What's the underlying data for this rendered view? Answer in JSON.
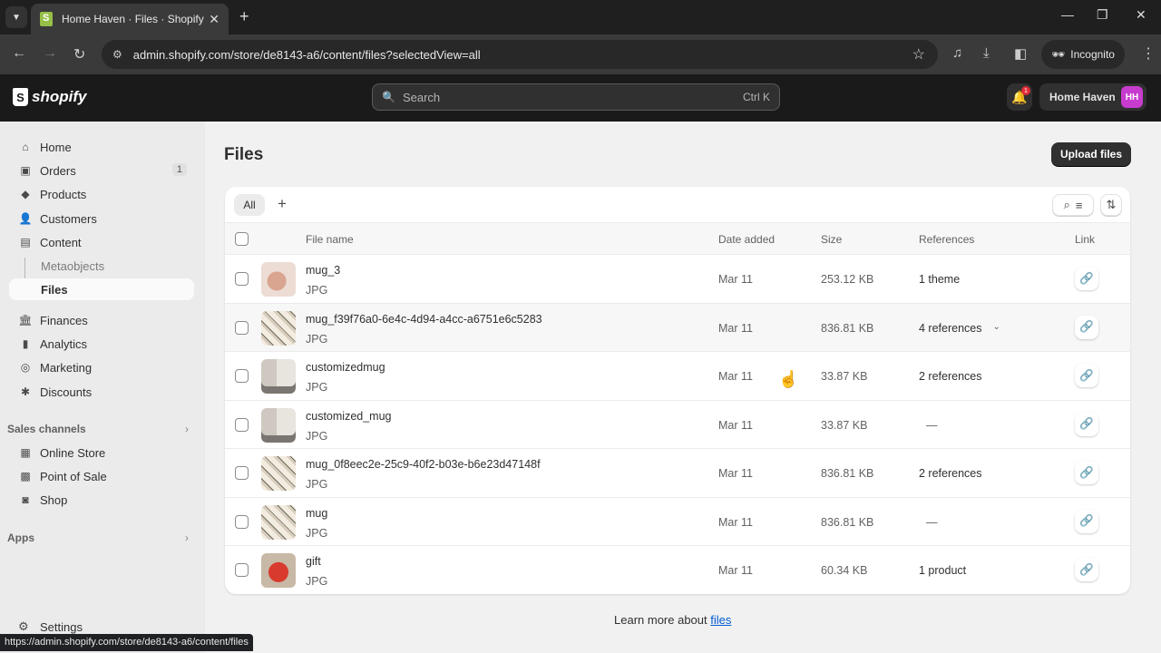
{
  "browser": {
    "tab_title": "Home Haven · Files · Shopify",
    "url": "admin.shopify.com/store/de8143-a6/content/files?selectedView=all",
    "profile_label": "Incognito",
    "status_url": "https://admin.shopify.com/store/de8143-a6/content/files"
  },
  "topbar": {
    "logo_text": "shopify",
    "search_placeholder": "Search",
    "search_shortcut": "Ctrl K",
    "notification_count": "1",
    "store_name": "Home Haven",
    "store_initials": "HH"
  },
  "sidebar": {
    "items": [
      {
        "label": "Home",
        "icon": "home-icon"
      },
      {
        "label": "Orders",
        "icon": "orders-icon",
        "count": "1"
      },
      {
        "label": "Products",
        "icon": "tag-icon"
      },
      {
        "label": "Customers",
        "icon": "person-icon"
      },
      {
        "label": "Content",
        "icon": "content-icon"
      }
    ],
    "content_subitems": [
      {
        "label": "Metaobjects"
      },
      {
        "label": "Files",
        "active": true
      }
    ],
    "items2": [
      {
        "label": "Finances",
        "icon": "bank-icon"
      },
      {
        "label": "Analytics",
        "icon": "bar-chart-icon"
      },
      {
        "label": "Marketing",
        "icon": "target-icon"
      },
      {
        "label": "Discounts",
        "icon": "discount-icon"
      }
    ],
    "sales_channels_label": "Sales channels",
    "sales_channels": [
      {
        "label": "Online Store",
        "icon": "store-icon"
      },
      {
        "label": "Point of Sale",
        "icon": "pos-icon"
      },
      {
        "label": "Shop",
        "icon": "shop-icon"
      }
    ],
    "apps_label": "Apps",
    "settings_label": "Settings"
  },
  "main": {
    "title": "Files",
    "upload_button": "Upload files",
    "view_tab": "All",
    "columns": {
      "file_name": "File name",
      "date_added": "Date added",
      "size": "Size",
      "references": "References",
      "link": "Link"
    },
    "rows": [
      {
        "name": "mug_3",
        "type": "JPG",
        "date": "Mar 11",
        "size": "253.12 KB",
        "refs": "1 theme",
        "thumb": "pink-mug"
      },
      {
        "name": "mug_f39f76a0-6e4c-4d94-a4cc-a6751e6c5283",
        "type": "JPG",
        "date": "Mar 11",
        "size": "836.81 KB",
        "refs": "4 references",
        "expandable": true,
        "thumb": "mug-collage"
      },
      {
        "name": "customizedmug",
        "type": "JPG",
        "date": "Mar 11",
        "size": "33.87 KB",
        "refs": "2 references",
        "thumb": "custom-mug"
      },
      {
        "name": "customized_mug",
        "type": "JPG",
        "date": "Mar 11",
        "size": "33.87 KB",
        "refs": "—",
        "thumb": "custom-mug"
      },
      {
        "name": "mug_0f8eec2e-25c9-40f2-b03e-b6e23d47148f",
        "type": "JPG",
        "date": "Mar 11",
        "size": "836.81 KB",
        "refs": "2 references",
        "thumb": "mug-collage"
      },
      {
        "name": "mug",
        "type": "JPG",
        "date": "Mar 11",
        "size": "836.81 KB",
        "refs": "—",
        "thumb": "mug-collage"
      },
      {
        "name": "gift",
        "type": "JPG",
        "date": "Mar 11",
        "size": "60.34 KB",
        "refs": "1 product",
        "thumb": "gift"
      }
    ],
    "learn_more_prefix": "Learn more about",
    "learn_more_link": "files"
  }
}
